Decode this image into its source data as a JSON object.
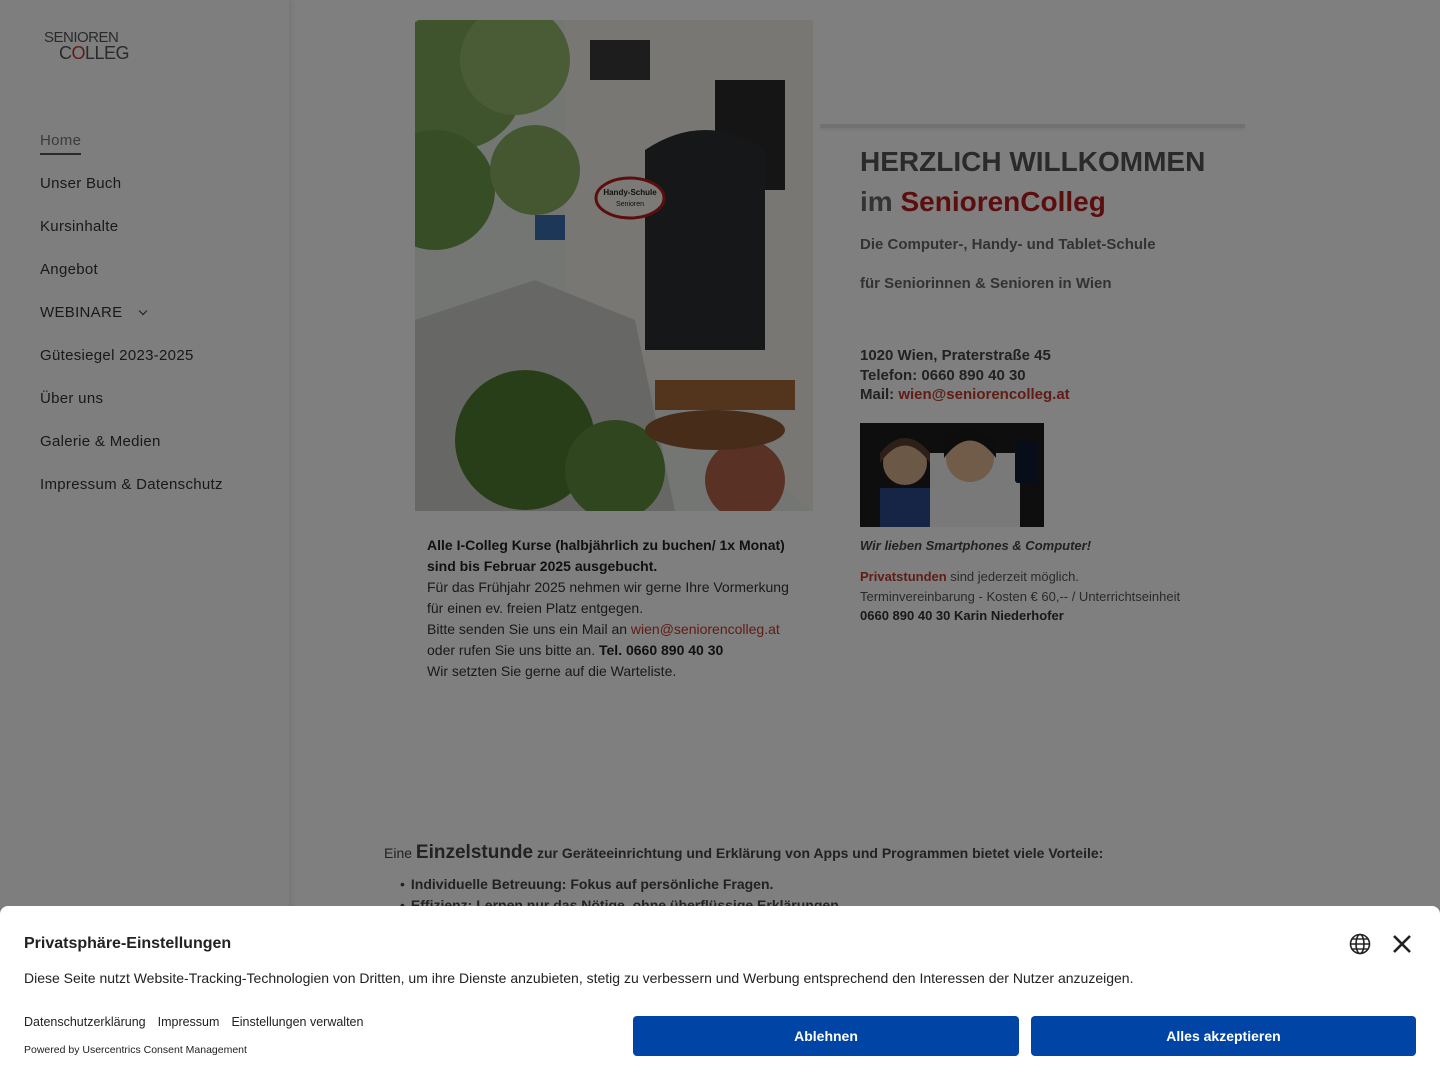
{
  "logo": {
    "line1": "SENIOREN",
    "line2_prefix": "C",
    "line2_o": "O",
    "line2_suffix": "LLEG"
  },
  "nav": [
    {
      "label": "Home"
    },
    {
      "label": "Unser Buch"
    },
    {
      "label": "Kursinhalte"
    },
    {
      "label": "Angebot"
    },
    {
      "label": "WEBINARE"
    },
    {
      "label": "Gütesiegel 2023-2025"
    },
    {
      "label": "Über uns"
    },
    {
      "label": "Galerie & Medien"
    },
    {
      "label": "Impressum & Datenschutz"
    }
  ],
  "hero": {
    "sign_line1": "Handy-Schule",
    "sign_line2": "Senioren"
  },
  "teaser": {
    "bold1": "Alle I-Colleg Kurse (halbjährlich zu buchen/ 1x Monat) sind bis Februar 2025 ausgebucht.",
    "line1": "Für das Frühjahr 2025 nehmen wir gerne Ihre Vormerkung für einen ev. freien Platz entgegen.",
    "line2_pre": "Bitte senden Sie uns ein Mail an ",
    "line2_link": "wien@seniorencolleg.at",
    "line3_pre": "oder rufen Sie uns bitte an. ",
    "line3_bold": "Tel. 0660 890 40 30",
    "line4": "Wir setzten Sie gerne auf die Warteliste."
  },
  "welcome": {
    "title1": "HERZLICH WILLKOMMEN",
    "title2_pre": "im ",
    "title2_brand": "SeniorenColleg",
    "sub1": "Die Computer-, Handy- und Tablet-Schule",
    "sub2": "für Seniorinnen & Senioren in Wien",
    "address": "1020 Wien, Praterstraße 45",
    "phone": "Telefon: 0660 890 40 30",
    "mail_label": "Mail: ",
    "mail": "wien@seniorencolleg.at",
    "caption": "Wir lieben Smartphones & Computer!",
    "privat_link": "Privatstunden",
    "privat_rest": " sind jederzeit möglich.",
    "privat_line2": "Terminvereinbarung - Kosten € 60,-- / Unterrichtseinheit",
    "privat_line3": "0660 890 40 30 Karin Niederhofer"
  },
  "einzel": {
    "pre": "Eine ",
    "big": "Einzelstunde",
    "post": " zur Geräteeinrichtung und Erklärung von Apps und Programmen bietet viele Vorteile:",
    "bullets": [
      "Individuelle Betreuung: Fokus auf persönliche Fragen.",
      "Effizienz: Lernen nur das Nötige, ohne überflüssige Erklärungen."
    ]
  },
  "consent": {
    "title": "Privatsphäre-Einstellungen",
    "text": "Diese Seite nutzt Website-Tracking-Technologien von Dritten, um ihre Dienste anzubieten, stetig zu verbessern und Werbung entsprechend den Interessen der Nutzer anzuzeigen.",
    "links": [
      "Datenschutzerklärung",
      "Impressum",
      "Einstellungen verwalten"
    ],
    "powered": "Powered by Usercentrics Consent Management",
    "decline": "Ablehnen",
    "accept": "Alles akzeptieren"
  }
}
